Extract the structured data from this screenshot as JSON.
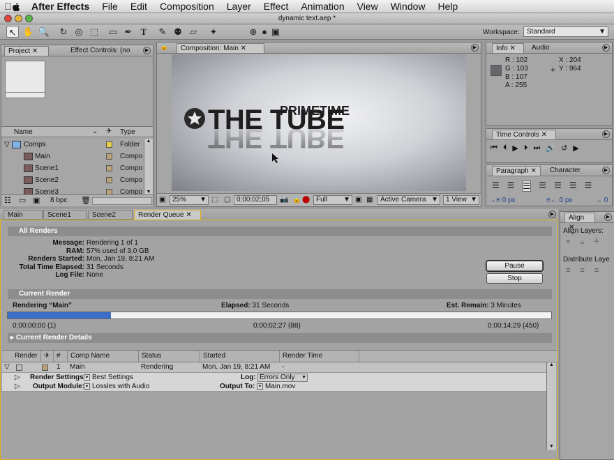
{
  "menu": {
    "apple": "",
    "items": [
      "After Effects",
      "File",
      "Edit",
      "Composition",
      "Layer",
      "Effect",
      "Animation",
      "View",
      "Window",
      "Help"
    ]
  },
  "window": {
    "title": "dynamic text.aep *"
  },
  "workspace": {
    "label": "Workspace:",
    "value": "Standard"
  },
  "project": {
    "tabs": [
      "Project",
      "Effect Controls: (no"
    ],
    "columns": {
      "name": "Name",
      "type": "Type"
    },
    "rows": [
      {
        "name": "Comps",
        "type": "Folder"
      },
      {
        "name": "Main",
        "type": "Compo"
      },
      {
        "name": "Scene1",
        "type": "Compo"
      },
      {
        "name": "Scene2",
        "type": "Compo"
      },
      {
        "name": "Scene3",
        "type": "Compo"
      }
    ],
    "bpc": "8 bpc"
  },
  "composition": {
    "tab": "Composition: Main",
    "graphic": {
      "small": "PRIMETIME",
      "big": "THE TUBE"
    },
    "zoom": "25%",
    "timecode": "0;00;02;05",
    "resolution": "Full",
    "camera": "Active Camera",
    "views": "1 View"
  },
  "info": {
    "tabs": [
      "Info",
      "Audio"
    ],
    "r": "R : 102",
    "g": "G : 103",
    "b": "B : 107",
    "a": "A : 255",
    "x": "X : 204",
    "y": "Y : 964"
  },
  "time_controls": {
    "tab": "Time Controls"
  },
  "paragraph": {
    "tabs": [
      "Paragraph",
      "Character"
    ],
    "indent1": "0 px",
    "indent2": "0 px",
    "indent3": "0"
  },
  "align": {
    "tab": "Align",
    "align_layers": "Align Layers:",
    "distribute_layers": "Distribute Laye"
  },
  "bottom_tabs": [
    "Main",
    "Scene1",
    "Scene2",
    "Render Queue"
  ],
  "render_queue": {
    "all_renders": "All Renders",
    "labels": {
      "message": "Message:",
      "ram": "RAM:",
      "started": "Renders Started:",
      "elapsed": "Total Time Elapsed:",
      "log": "Log File:"
    },
    "values": {
      "message": "Rendering 1 of 1",
      "ram": "57% used of 3.0 GB",
      "started": "Mon, Jan 19, 8:21 AM",
      "elapsed": "31 Seconds",
      "log": "None"
    },
    "pause": "Pause",
    "stop": "Stop",
    "current_render": "Current Render",
    "rendering": "Rendering “Main”",
    "elapsed_label": "Elapsed:",
    "elapsed_value": "31 Seconds",
    "remain_label": "Est. Remain:",
    "remain_value": "3 Minutes",
    "progress": 0.19,
    "tc_start": "0;00;00;00 (1)",
    "tc_current": "0;00;02;27 (88)",
    "tc_end": "0;00;14;29 (450)",
    "details": "Current Render Details",
    "columns": {
      "render": "Render",
      "num": "#",
      "comp": "Comp Name",
      "status": "Status",
      "started": "Started",
      "time": "Render Time"
    },
    "item": {
      "num": "1",
      "comp": "Main",
      "status": "Rendering",
      "started": "Mon, Jan 19, 8:21 AM",
      "time": "-"
    },
    "render_settings_label": "Render Settings:",
    "render_settings": "Best Settings",
    "log_label": "Log:",
    "log_value": "Errors Only",
    "output_module_label": "Output Module:",
    "output_module": "Lossles with Audio",
    "output_to_label": "Output To:",
    "output_to": "Main.mov"
  },
  "colors": {
    "accent_yellow": "#e0b020",
    "progress_blue": "#3c6ec8",
    "label_swatch": "#b8a378",
    "folder_swatch": "#e6d24a"
  }
}
